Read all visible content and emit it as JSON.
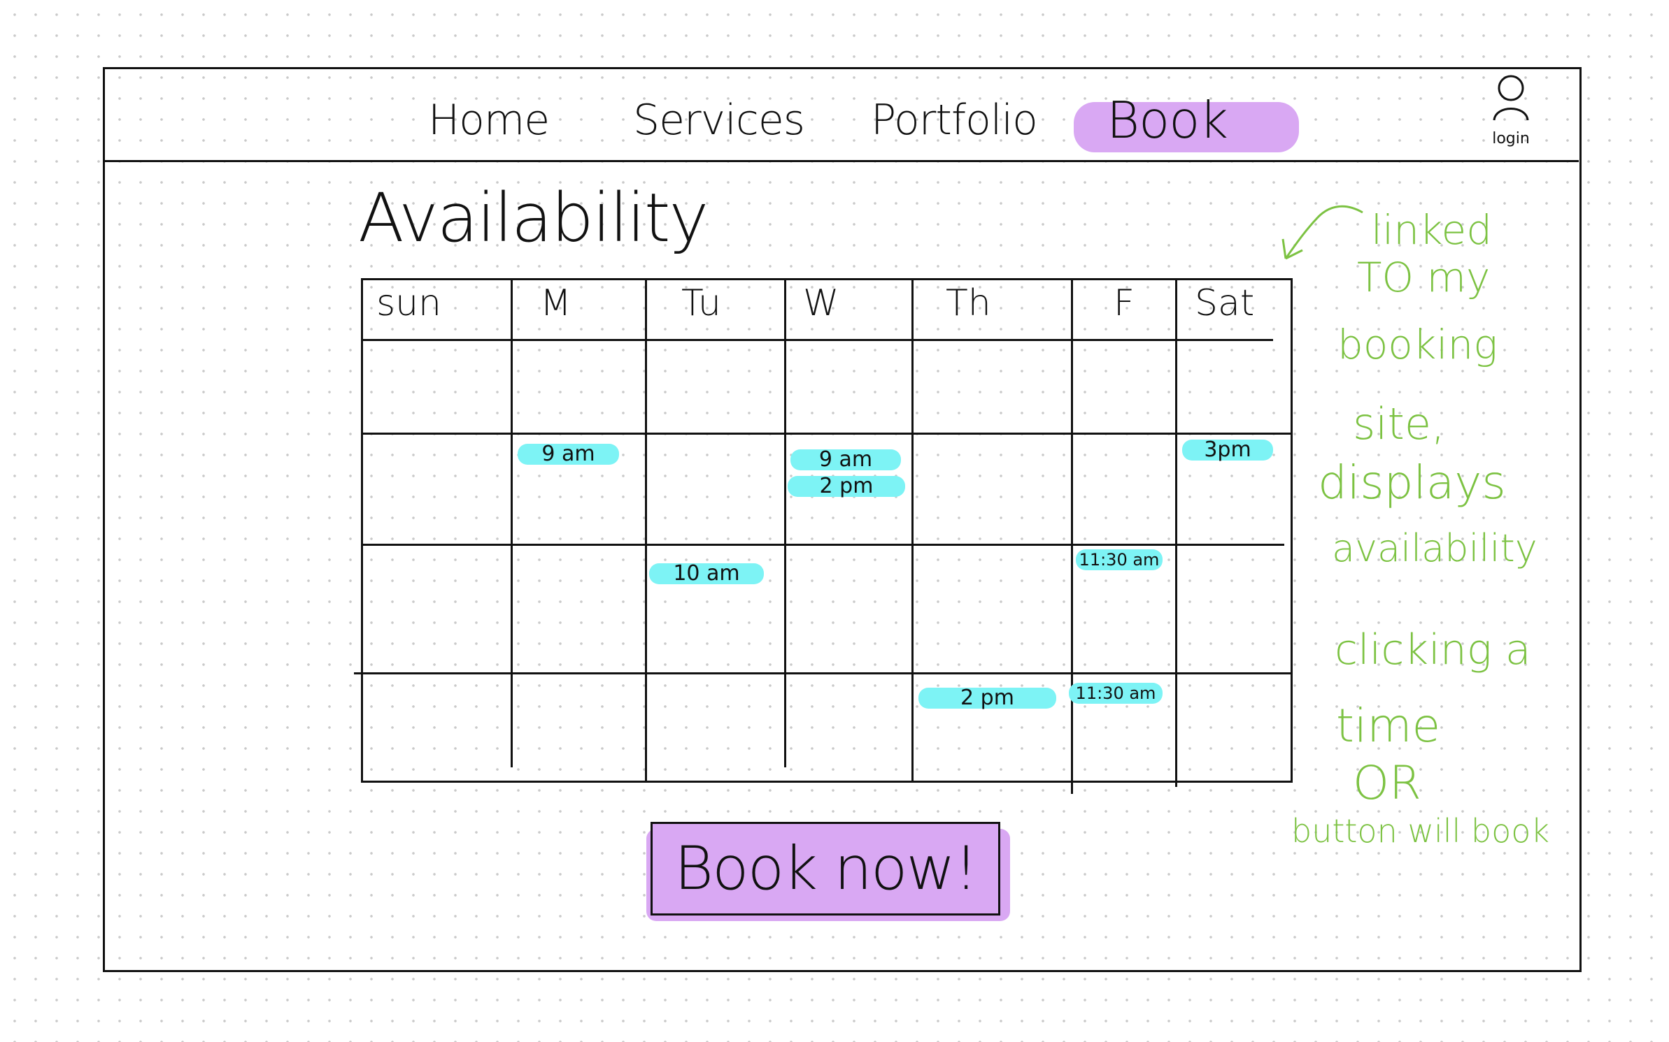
{
  "nav": {
    "items": [
      {
        "label": "Home"
      },
      {
        "label": "Services"
      },
      {
        "label": "Portfolio"
      },
      {
        "label": "Book"
      }
    ],
    "active": "Book",
    "login_label": "login"
  },
  "page": {
    "title": "Availability"
  },
  "calendar": {
    "days": [
      "sun",
      "M",
      "Tu",
      "W",
      "Th",
      "F",
      "Sat"
    ],
    "rows": 4,
    "available_slots": [
      {
        "day": "M",
        "row": 2,
        "time": "9 am"
      },
      {
        "day": "W",
        "row": 2,
        "time": "9 am"
      },
      {
        "day": "W",
        "row": 2,
        "time": "2 pm"
      },
      {
        "day": "Sat",
        "row": 2,
        "time": "3pm"
      },
      {
        "day": "Tu",
        "row": 3,
        "time": "10 am"
      },
      {
        "day": "F",
        "row": 3,
        "time": "11:30 am"
      },
      {
        "day": "Th",
        "row": 4,
        "time": "2 pm"
      },
      {
        "day": "F",
        "row": 4,
        "time": "11:30 am"
      }
    ]
  },
  "book_button": {
    "label": "Book now!"
  },
  "annotations": {
    "note1": [
      "linked",
      "TO my",
      "booking",
      "site,",
      "displays",
      "availability"
    ],
    "note2": [
      "clicking a",
      "time",
      "OR",
      "button will book"
    ]
  },
  "colors": {
    "active_highlight": "#d9a8f3",
    "slot_highlight": "#7df3f5",
    "annotation": "#7cc242",
    "ink": "#111111"
  }
}
